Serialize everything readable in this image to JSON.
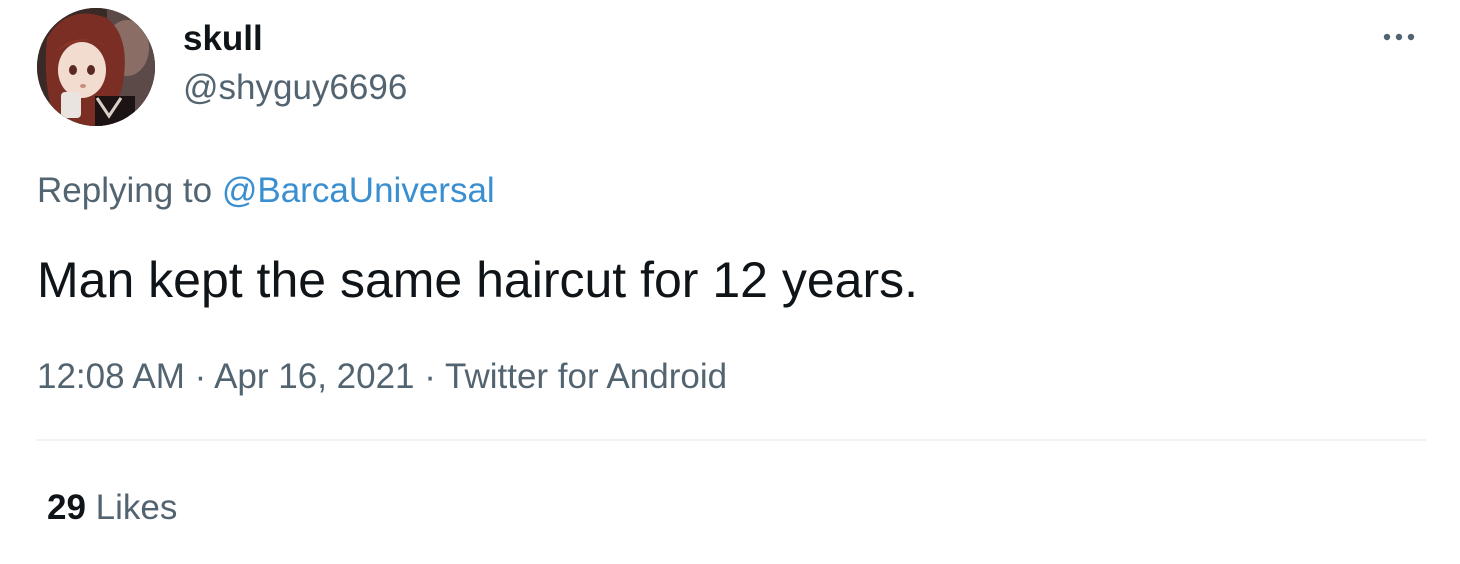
{
  "author": {
    "display_name": "skull",
    "handle": "@shyguy6696",
    "avatar": "anime-character-avatar"
  },
  "more_icon": "more-horizontal-icon",
  "reply": {
    "prefix": "Replying to",
    "mention": "@BarcaUniversal"
  },
  "tweet": {
    "text": "Man kept the same haircut for 12 years."
  },
  "meta": {
    "time": "12:08 AM",
    "separator": "·",
    "date": "Apr 16, 2021",
    "source": "Twitter for Android"
  },
  "stats": {
    "likes_count": "29",
    "likes_label": "Likes"
  },
  "colors": {
    "primary_text": "#0f1419",
    "secondary_text": "#536471",
    "link": "#3a8fd0",
    "divider": "#eff3f4"
  }
}
